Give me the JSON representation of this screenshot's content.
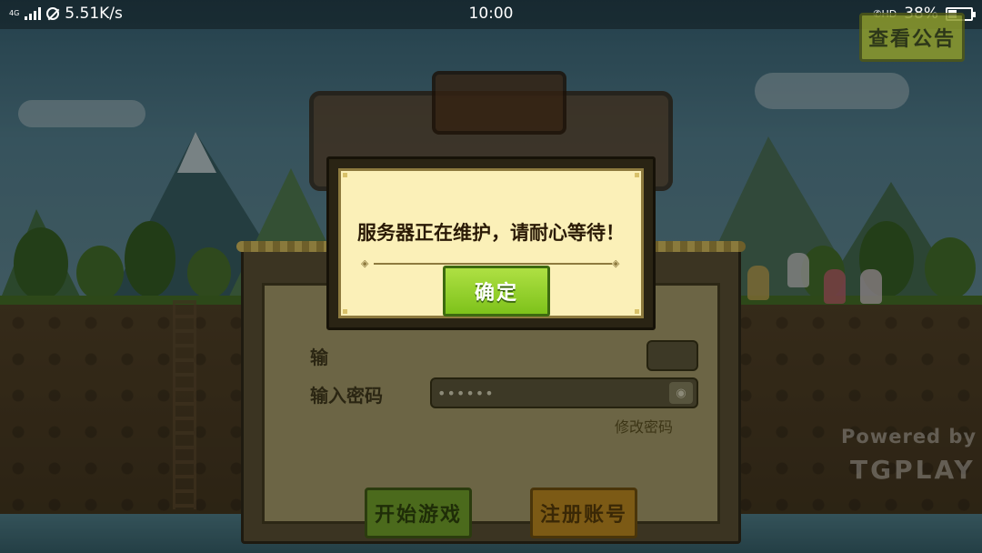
{
  "status_bar": {
    "network": "4G",
    "speed": "5.51K/s",
    "time": "10:00",
    "hd": "HD",
    "battery_percent": "38%",
    "battery_level": 0.38
  },
  "top_button": {
    "label": "查看公告"
  },
  "login_panel": {
    "username_label": "输",
    "password_label": "输入密码",
    "password_value": "••••••",
    "change_password": "修改密码",
    "start_button": "开始游戏",
    "register_button": "注册账号"
  },
  "modal": {
    "message": "服务器正在维护，请耐心等待！",
    "confirm_button": "确定"
  },
  "watermark": {
    "powered": "Powered by",
    "brand": "TGPLAY"
  },
  "colors": {
    "confirm_green": "#8fd22b",
    "paper": "#fbf0b8",
    "panel_dark": "#2a2414"
  }
}
